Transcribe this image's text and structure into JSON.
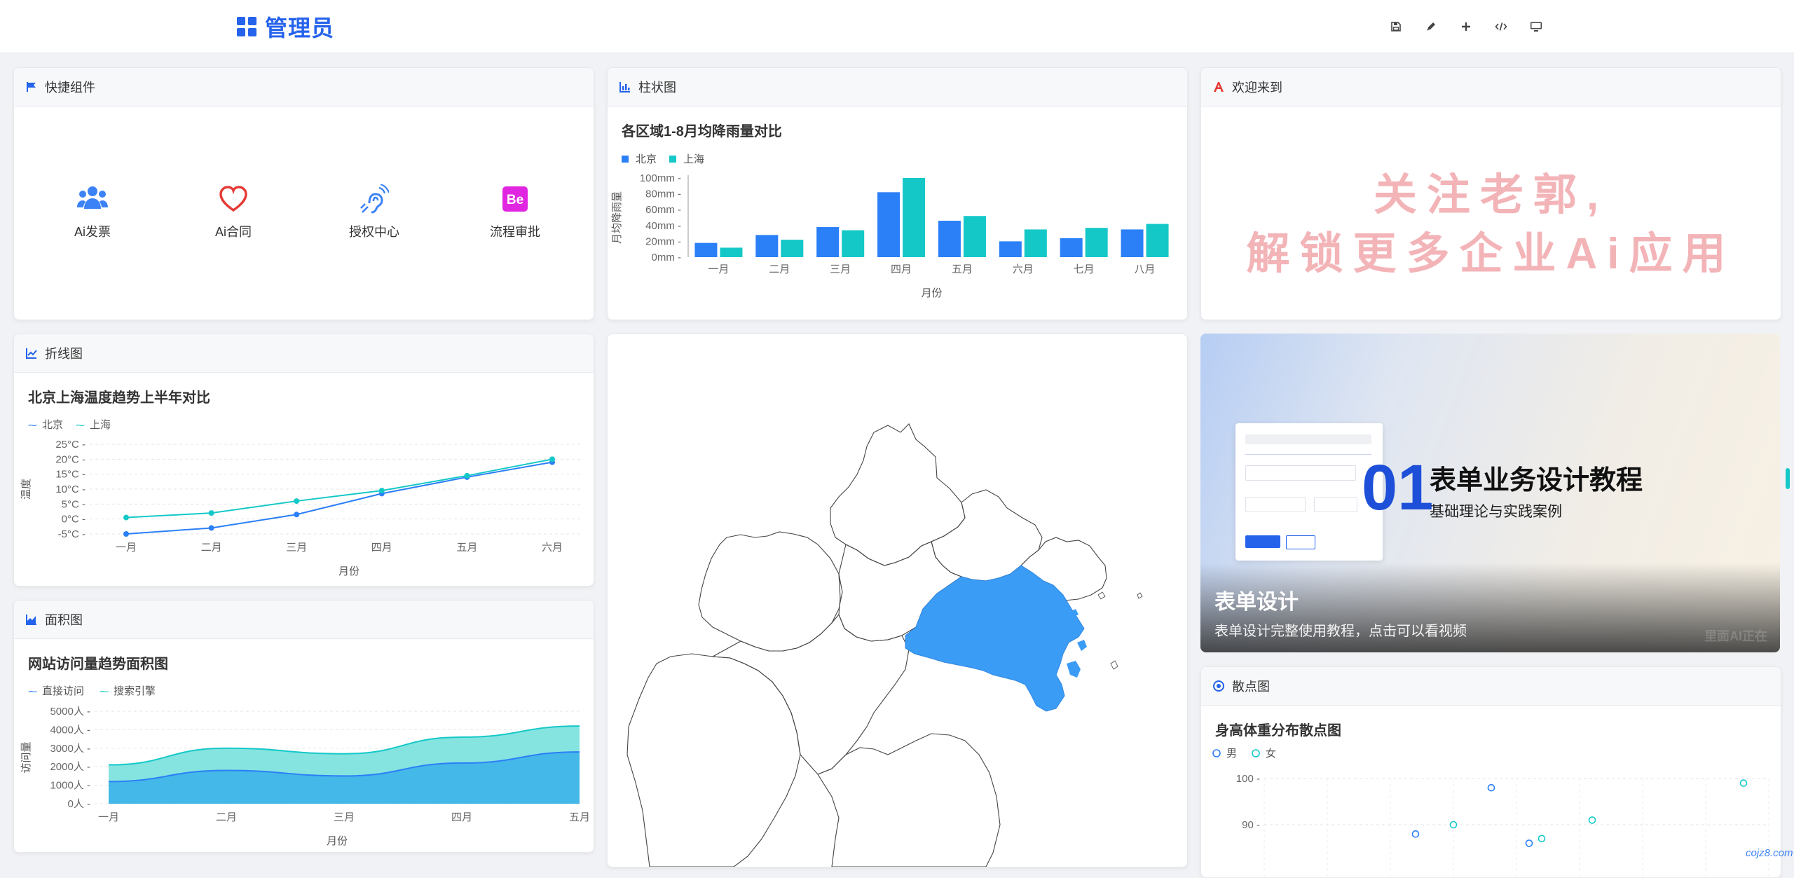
{
  "header": {
    "title": "管理员"
  },
  "toolbar": {
    "icons": [
      "save-icon",
      "pencil-icon",
      "plus-icon",
      "code-icon",
      "monitor-icon"
    ]
  },
  "colors": {
    "accent": "#2563eb",
    "blue": "#2b7ff7",
    "teal": "#15c8c8",
    "pink_text": "#f3b4b8",
    "map_highlight": "#3b9cf6"
  },
  "quick": {
    "title": "快捷组件",
    "items": [
      {
        "label": "Ai发票",
        "icon": "users-icon"
      },
      {
        "label": "Ai合同",
        "icon": "heart-icon"
      },
      {
        "label": "授权中心",
        "icon": "hearing-icon"
      },
      {
        "label": "流程审批",
        "icon": "behance-icon"
      }
    ]
  },
  "bar": {
    "title": "柱状图",
    "chart_title": "各区域1-8月均降雨量对比",
    "legend": [
      "北京",
      "上海"
    ],
    "ylabel": "月均降雨量",
    "xlabel": "月份"
  },
  "welcome": {
    "title": "欢迎来到",
    "line1": "关注老郭,",
    "line2": "解锁更多企业Ai应用"
  },
  "line": {
    "title": "折线图",
    "chart_title": "北京上海温度趋势上半年对比",
    "legend": [
      "北京",
      "上海"
    ],
    "ylabel": "温度",
    "xlabel": "月份"
  },
  "banner": {
    "number": "01",
    "heading": "表单业务设计教程",
    "sub": "基础理论与实践案例",
    "caption_title": "表单设计",
    "caption_text": "表单设计完整使用教程，点击可以看视频",
    "watermark": "里面AI正在"
  },
  "area": {
    "title": "面积图",
    "chart_title": "网站访问量趋势面积图",
    "legend": [
      "直接访问",
      "搜索引擎"
    ],
    "ylabel": "访问量",
    "xlabel": "月份"
  },
  "scatter": {
    "title": "散点图",
    "chart_title": "身高体重分布散点图",
    "legend": [
      "男",
      "女"
    ]
  },
  "site_watermark": "cojz8.com",
  "chart_data": [
    {
      "type": "bar",
      "title": "各区域1-8月均降雨量对比",
      "categories": [
        "一月",
        "二月",
        "三月",
        "四月",
        "五月",
        "六月",
        "七月",
        "八月"
      ],
      "series": [
        {
          "name": "北京",
          "values": [
            18,
            28,
            38,
            82,
            46,
            20,
            24,
            35
          ]
        },
        {
          "name": "上海",
          "values": [
            12,
            22,
            34,
            100,
            52,
            35,
            37,
            42
          ]
        }
      ],
      "yticks": [
        "0mm",
        "20mm",
        "40mm",
        "60mm",
        "80mm",
        "100mm"
      ],
      "ylim": [
        0,
        100
      ],
      "xlabel": "月份",
      "ylabel": "月均降雨量",
      "legend_position": "top-left",
      "grid": false
    },
    {
      "type": "line",
      "title": "北京上海温度趋势上半年对比",
      "categories": [
        "一月",
        "二月",
        "三月",
        "四月",
        "五月",
        "六月"
      ],
      "series": [
        {
          "name": "北京",
          "values": [
            -5,
            -3,
            1.5,
            8.5,
            14,
            19
          ]
        },
        {
          "name": "上海",
          "values": [
            0.5,
            2,
            6,
            9.5,
            14.5,
            20
          ]
        }
      ],
      "yticks": [
        "-5°C",
        "0°C",
        "5°C",
        "10°C",
        "15°C",
        "20°C",
        "25°C"
      ],
      "ylim": [
        -5,
        25
      ],
      "xlabel": "月份",
      "ylabel": "温度",
      "legend_position": "top-left",
      "grid": true
    },
    {
      "type": "area",
      "title": "网站访问量趋势面积图",
      "categories": [
        "一月",
        "二月",
        "三月",
        "四月",
        "五月"
      ],
      "series": [
        {
          "name": "直接访问",
          "values": [
            1200,
            1800,
            1500,
            2200,
            2800
          ]
        },
        {
          "name": "搜索引擎",
          "values": [
            2100,
            3000,
            2700,
            3600,
            4200
          ]
        }
      ],
      "yticks": [
        "0人",
        "1000人",
        "2000人",
        "3000人",
        "4000人",
        "5000人"
      ],
      "ylim": [
        0,
        5000
      ],
      "xlabel": "月份",
      "ylabel": "访问量",
      "legend_position": "top-left",
      "grid": true
    },
    {
      "type": "scatter",
      "title": "身高体重分布散点图",
      "series": [
        {
          "name": "男",
          "points": [
            [
              172,
              88
            ],
            [
              178,
              98
            ],
            [
              181,
              86
            ]
          ]
        },
        {
          "name": "女",
          "points": [
            [
              175,
              90
            ],
            [
              182,
              87
            ],
            [
              186,
              91
            ],
            [
              198,
              99
            ]
          ]
        }
      ],
      "yticks": [
        "90",
        "100"
      ],
      "ylim": [
        86,
        101
      ],
      "xlim": [
        160,
        200
      ],
      "legend_position": "top-left",
      "grid": true
    }
  ]
}
